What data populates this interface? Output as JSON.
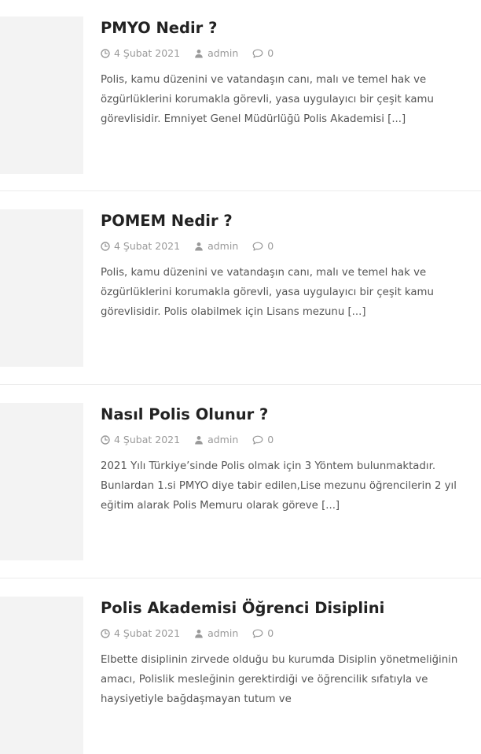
{
  "posts": [
    {
      "title": "PMYO Nedir ?",
      "date": "4 Şubat 2021",
      "author": "admin",
      "comments": "0",
      "excerpt": "Polis, kamu düzenini ve vatandaşın canı, malı ve temel hak ve özgürlüklerini korumakla görevli, yasa uygulayıcı bir çeşit kamu görevlisidir. Emniyet Genel Müdürlüğü Polis Akademisi",
      "more": "[...]"
    },
    {
      "title": "POMEM Nedir ?",
      "date": "4 Şubat 2021",
      "author": "admin",
      "comments": "0",
      "excerpt": "Polis, kamu düzenini ve vatandaşın canı, malı ve temel hak ve özgürlüklerini korumakla görevli, yasa uygulayıcı bir çeşit kamu görevlisidir. Polis olabilmek için Lisans mezunu",
      "more": "[...]"
    },
    {
      "title": "Nasıl Polis Olunur ?",
      "date": "4 Şubat 2021",
      "author": "admin",
      "comments": "0",
      "excerpt": "2021 Yılı Türkiye’sinde Polis olmak için 3 Yöntem bulunmaktadır. Bunlardan 1.si PMYO diye tabir edilen,Lise mezunu öğrencilerin 2 yıl eğitim alarak Polis Memuru olarak göreve",
      "more": "[...]"
    },
    {
      "title": "Polis Akademisi Öğrenci Disiplini",
      "date": "4 Şubat 2021",
      "author": "admin",
      "comments": "0",
      "excerpt": "Elbette disiplinin zirvede olduğu bu kurumda Disiplin yönetmeliğinin amacı, Polislik mesleğinin gerektirdiği ve öğrencilik sıfatıyla ve haysiyetiyle bağdaşmayan tutum ve",
      "more": ""
    }
  ],
  "icons": {
    "date": "clock-icon",
    "author": "user-icon",
    "comments": "comment-icon"
  },
  "colors": {
    "title": "#222222",
    "meta": "#9a9a9a",
    "excerpt": "#555555",
    "thumb_placeholder": "#f3f3f3",
    "divider": "#ececec"
  }
}
